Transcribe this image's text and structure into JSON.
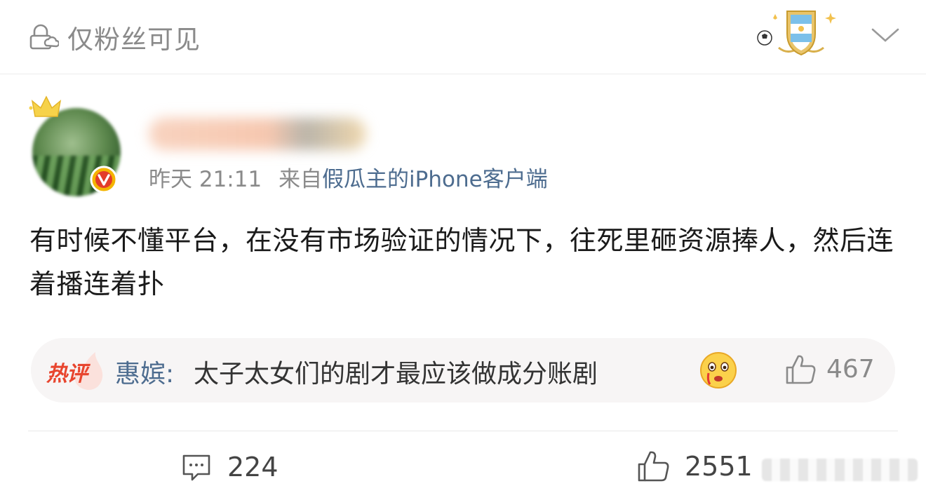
{
  "header": {
    "visibility_icon": "lock-cloud-icon",
    "visibility_label": "仅粉丝可见",
    "badge_icon": "argentina-football-badge-icon",
    "menu_icon": "chevron-down-icon"
  },
  "author": {
    "avatar_icon": "avatar-watermelon",
    "crown_icon": "crown-icon",
    "verified_icon": "verified-v-icon",
    "name": "",
    "time": "昨天 21:11",
    "source_prefix": "来自",
    "source_device": "假瓜主的iPhone客户端"
  },
  "post": {
    "text": "有时候不懂平台，在没有市场验证的情况下，往死里砸资源捧人，然后连着播连着扑"
  },
  "hot_comment": {
    "label": "热评",
    "user": "惠嫔:",
    "text": "太子太女们的剧才最应该做成分账剧",
    "emoji_icon": "tearful-face-emoji",
    "like_icon": "thumbs-up-icon",
    "like_count": "467"
  },
  "actions": {
    "comment_icon": "comment-icon",
    "comment_count": "224",
    "like_icon": "thumbs-up-icon",
    "like_count": "2551"
  },
  "colors": {
    "link_blue": "#4d6c8f",
    "hot_red": "#e8452e",
    "gray_text": "#8a8a8a"
  }
}
